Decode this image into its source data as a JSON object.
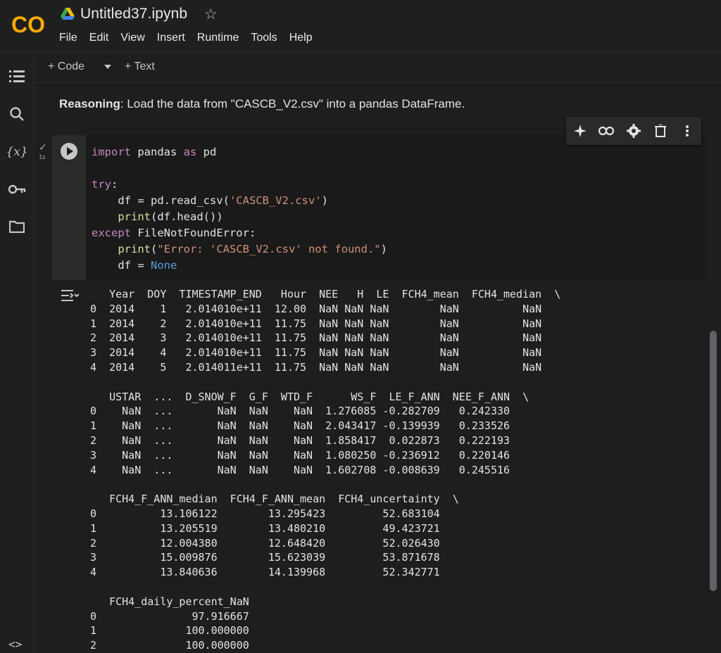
{
  "app": {
    "logo_text": "CO",
    "notebook_title": "Untitled37.ipynb",
    "star_icon": "star-icon",
    "drive_icon": "google-drive-icon"
  },
  "menu": [
    "File",
    "Edit",
    "View",
    "Insert",
    "Runtime",
    "Tools",
    "Help"
  ],
  "toolbar": {
    "add_code": "+ Code",
    "dropdown_icon": "chevron-down-icon",
    "add_text": "+ Text"
  },
  "rail": [
    "table-of-contents-icon",
    "search-icon",
    "variables-icon",
    "secrets-key-icon",
    "files-folder-icon",
    "code-snippets-icon"
  ],
  "text_cell": {
    "bold": "Reasoning",
    "rest": ": Load the data from \"CASCB_V2.csv\" into a pandas DataFrame."
  },
  "cell_toolbar": [
    "gemini-sparkle-icon",
    "link-icon",
    "settings-gear-icon",
    "delete-trash-icon",
    "more-vert-icon"
  ],
  "exec": {
    "status": "✓",
    "time": "1s"
  },
  "code": {
    "l1_kw": "import",
    "l1_a": " pandas ",
    "l1_kw2": "as",
    "l1_b": " pd",
    "l3_kw": "try",
    "l3_b": ":",
    "l4_a": "    df = pd.read_csv(",
    "l4_str": "'CASCB_V2.csv'",
    "l4_b": ")",
    "l5_a": "    ",
    "l5_fn": "print",
    "l5_b": "(df.head())",
    "l6_kw": "except",
    "l6_b": " FileNotFoundError:",
    "l7_a": "    ",
    "l7_fn": "print",
    "l7_b": "(",
    "l7_str": "\"Error: 'CASCB_V2.csv' not found.\"",
    "l7_c": ")",
    "l8_a": "    df = ",
    "l8_con": "None"
  },
  "output": [
    "   Year  DOY  TIMESTAMP_END   Hour  NEE   H  LE  FCH4_mean  FCH4_median  \\",
    "0  2014    1   2.014010e+11  12.00  NaN NaN NaN        NaN          NaN",
    "1  2014    2   2.014010e+11  11.75  NaN NaN NaN        NaN          NaN",
    "2  2014    3   2.014010e+11  11.75  NaN NaN NaN        NaN          NaN",
    "3  2014    4   2.014010e+11  11.75  NaN NaN NaN        NaN          NaN",
    "4  2014    5   2.014011e+11  11.75  NaN NaN NaN        NaN          NaN",
    "",
    "   USTAR  ...  D_SNOW_F  G_F  WTD_F      WS_F  LE_F_ANN  NEE_F_ANN  \\",
    "0    NaN  ...       NaN  NaN    NaN  1.276085 -0.282709   0.242330",
    "1    NaN  ...       NaN  NaN    NaN  2.043417 -0.139939   0.233526",
    "2    NaN  ...       NaN  NaN    NaN  1.858417  0.022873   0.222193",
    "3    NaN  ...       NaN  NaN    NaN  1.080250 -0.236912   0.220146",
    "4    NaN  ...       NaN  NaN    NaN  1.602708 -0.008639   0.245516",
    "",
    "   FCH4_F_ANN_median  FCH4_F_ANN_mean  FCH4_uncertainty  \\",
    "0          13.106122        13.295423         52.683104",
    "1          13.205519        13.480210         49.423721",
    "2          12.004380        12.648420         52.026430",
    "3          15.009876        15.623039         53.871678",
    "4          13.840636        14.139968         52.342771",
    "",
    "   FCH4_daily_percent_NaN",
    "0               97.916667",
    "1              100.000000",
    "2              100.000000"
  ],
  "output_icon": "output-collapse-icon",
  "code_toggle": "<>"
}
